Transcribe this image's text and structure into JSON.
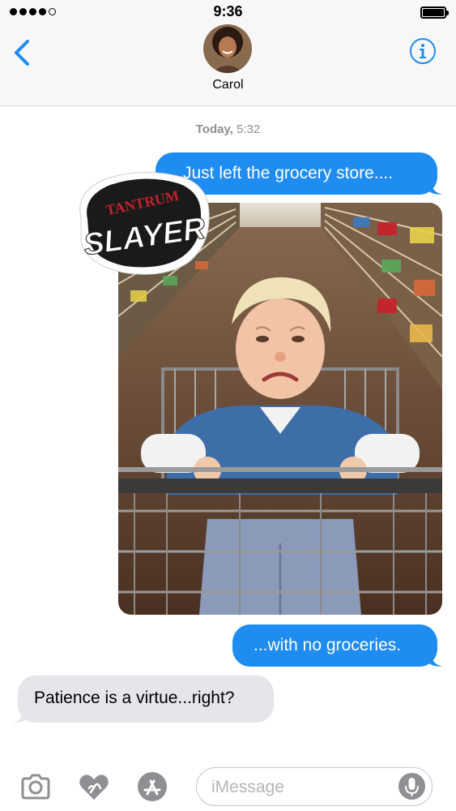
{
  "status_bar": {
    "time": "9:36",
    "signal_bars": 4,
    "signal_total": 5,
    "battery_level": 1.0
  },
  "header": {
    "contact_name": "Carol",
    "back_icon": "chevron-left-icon",
    "info_icon": "info-icon"
  },
  "thread": {
    "timestamp_day": "Today,",
    "timestamp_time": "5:32",
    "messages": [
      {
        "direction": "outgoing",
        "text": "Just left the grocery store...."
      },
      {
        "direction": "outgoing",
        "type": "photo",
        "sticker_line1": "TANTRUM",
        "sticker_line2": "SLAYER"
      },
      {
        "direction": "outgoing",
        "text": "...with no groceries."
      },
      {
        "direction": "incoming",
        "text": "Patience is a virtue...right?"
      }
    ]
  },
  "input_bar": {
    "placeholder": "iMessage",
    "value": "",
    "icons": [
      "camera-icon",
      "digital-touch-icon",
      "app-store-icon",
      "microphone-icon"
    ]
  },
  "colors": {
    "accent": "#1e8cf0",
    "outgoing_bubble": "#1e8cf0",
    "incoming_bubble": "#e5e5ea",
    "header_bg": "#f7f7f7",
    "sticker_red": "#c8202a"
  }
}
